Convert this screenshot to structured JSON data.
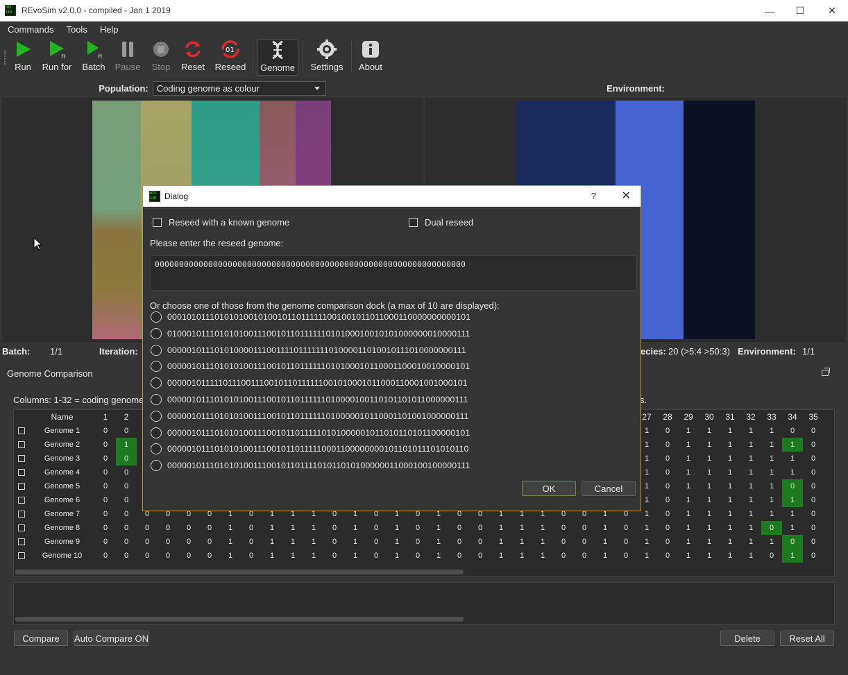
{
  "window": {
    "title": "REvoSim v2.0.0 - compiled - Jan  1 2019",
    "minimize": "—",
    "maximize": "☐",
    "close": "✕"
  },
  "menu": [
    "Commands",
    "Tools",
    "Help"
  ],
  "toolbar": [
    {
      "label": "Run",
      "name": "run-button",
      "icon": "play-icon",
      "disabled": false
    },
    {
      "label": "Run for",
      "name": "run-for-button",
      "icon": "play-n-icon",
      "disabled": false
    },
    {
      "label": "Batch",
      "name": "batch-button",
      "icon": "play-n-icon",
      "disabled": false
    },
    {
      "label": "Pause",
      "name": "pause-button",
      "icon": "pause-icon",
      "disabled": true
    },
    {
      "label": "Stop",
      "name": "stop-button",
      "icon": "stop-icon",
      "disabled": true
    },
    {
      "label": "Reset",
      "name": "reset-button",
      "icon": "reset-icon",
      "disabled": false
    },
    {
      "label": "Reseed",
      "name": "reseed-button",
      "icon": "reseed-icon",
      "disabled": false
    },
    {
      "label": "Genome",
      "name": "genome-button",
      "icon": "dna-icon",
      "disabled": false
    },
    {
      "label": "Settings",
      "name": "settings-button",
      "icon": "globe-gear-icon",
      "disabled": false
    },
    {
      "label": "About",
      "name": "about-button",
      "icon": "info-icon",
      "disabled": false
    }
  ],
  "population": {
    "label": "Population:",
    "view_mode": "Coding genome as colour"
  },
  "environment": {
    "label": "Environment:"
  },
  "status": {
    "batch_label": "Batch:",
    "batch_value": "1/1",
    "iteration_label": "Iteration:",
    "species_label": "ecies:",
    "species_value": "20 (>5:4 >50:3)",
    "environment_label": "Environment:",
    "environment_value": "1/1"
  },
  "dock": {
    "title": "Genome Comparison",
    "columns_note_left": "Columns: 1-32 = coding genome",
    "columns_note_right": "s.",
    "compare": "Compare",
    "auto_compare": "Auto Compare ON",
    "delete": "Delete",
    "reset_all": "Reset All"
  },
  "table": {
    "name_header": "Name",
    "left_cols": [
      "1",
      "2"
    ],
    "right_cols": [
      "27",
      "28",
      "29",
      "30",
      "31",
      "32",
      "33",
      "34",
      "35"
    ],
    "rows": [
      {
        "name": "Genome 1",
        "left": [
          "0",
          "0"
        ],
        "right": [
          "1",
          "0",
          "1",
          "1",
          "1",
          "1",
          "1",
          "0",
          "0"
        ]
      },
      {
        "name": "Genome 2",
        "left": [
          "0",
          "1"
        ],
        "right": [
          "1",
          "0",
          "1",
          "1",
          "1",
          "1",
          "1",
          "1",
          "0"
        ]
      },
      {
        "name": "Genome 3",
        "left": [
          "0",
          "0"
        ],
        "right": [
          "1",
          "0",
          "1",
          "1",
          "1",
          "1",
          "1",
          "1",
          "0"
        ]
      },
      {
        "name": "Genome 4",
        "left": [
          "0",
          "0"
        ],
        "right": [
          "1",
          "0",
          "1",
          "1",
          "1",
          "1",
          "1",
          "1",
          "0"
        ]
      },
      {
        "name": "Genome 5",
        "left": [
          "0",
          "0"
        ],
        "right": [
          "1",
          "0",
          "1",
          "1",
          "1",
          "1",
          "1",
          "0",
          "0"
        ]
      },
      {
        "name": "Genome 6",
        "left": [
          "0",
          "0"
        ],
        "right": [
          "1",
          "0",
          "1",
          "1",
          "1",
          "1",
          "1",
          "1",
          "0"
        ]
      },
      {
        "name": "Genome 7",
        "left": [
          "0",
          "0"
        ],
        "mid": [
          "0",
          "0",
          "0",
          "0",
          "1",
          "0",
          "1",
          "1",
          "1",
          "0",
          "1",
          "0",
          "1",
          "0",
          "1",
          "0",
          "0",
          "1",
          "1",
          "1",
          "0",
          "0",
          "1",
          "0",
          "1"
        ],
        "right": [
          "1",
          "0",
          "1",
          "1",
          "1",
          "1",
          "1",
          "1",
          "0"
        ]
      },
      {
        "name": "Genome 8",
        "left": [
          "0",
          "0"
        ],
        "mid": [
          "0",
          "0",
          "0",
          "0",
          "1",
          "0",
          "1",
          "1",
          "1",
          "0",
          "1",
          "0",
          "1",
          "0",
          "1",
          "0",
          "0",
          "1",
          "1",
          "1",
          "0",
          "0",
          "1",
          "0",
          "1"
        ],
        "right": [
          "1",
          "0",
          "1",
          "1",
          "1",
          "1",
          "0",
          "1",
          "0"
        ]
      },
      {
        "name": "Genome 9",
        "left": [
          "0",
          "0"
        ],
        "mid": [
          "0",
          "0",
          "0",
          "0",
          "1",
          "0",
          "1",
          "1",
          "1",
          "0",
          "1",
          "0",
          "1",
          "0",
          "1",
          "0",
          "0",
          "1",
          "1",
          "1",
          "0",
          "0",
          "1",
          "0",
          "1"
        ],
        "right": [
          "1",
          "0",
          "1",
          "1",
          "1",
          "1",
          "1",
          "0",
          "0"
        ]
      },
      {
        "name": "Genome 10",
        "left": [
          "0",
          "0"
        ],
        "mid": [
          "0",
          "0",
          "0",
          "0",
          "1",
          "0",
          "1",
          "1",
          "1",
          "0",
          "1",
          "0",
          "1",
          "0",
          "1",
          "0",
          "0",
          "1",
          "1",
          "1",
          "0",
          "0",
          "1",
          "0",
          "1"
        ],
        "right": [
          "1",
          "0",
          "1",
          "1",
          "1",
          "1",
          "0",
          "1",
          "0"
        ]
      }
    ]
  },
  "dialog": {
    "title": "Dialog",
    "help": "?",
    "close": "✕",
    "known_genome": "Reseed with a known genome",
    "dual_reseed": "Dual reseed",
    "prompt": "Please enter the reseed genome:",
    "genome_value": "0000000000000000000000000000000000000000000000000000000000000000",
    "choose_label": "Or choose one of those from the genome comparison dock (a max  of 10 are displayed):",
    "options": [
      "0001010111010101001010010110111111001001011011000110000000000101",
      "0100010111010101001110010110111111010100010010101000000010000111",
      "0000010111010100001110011110111111101000011010010111010000000111",
      "0000010111010101001110010110111111010100010110001100010010000101",
      "0000010111110111001110010110111111001010001011000110001001000101",
      "0000010111010101001110010110111111010000100110101101011000000111",
      "0000010111010101001110010110111111010000010110001101001000000111",
      "0000010111010101001110010110111110101000001011010110101100000101",
      "0000010111010101001110010110111110001100000000101101011101010110",
      "0000010111010101001110010110111101011010100000011000100100000111"
    ],
    "ok": "OK",
    "cancel": "Cancel"
  },
  "colors": {
    "accent_green": "#1e7a1e",
    "dialog_border": "#c79a2b",
    "background": "#353535"
  }
}
